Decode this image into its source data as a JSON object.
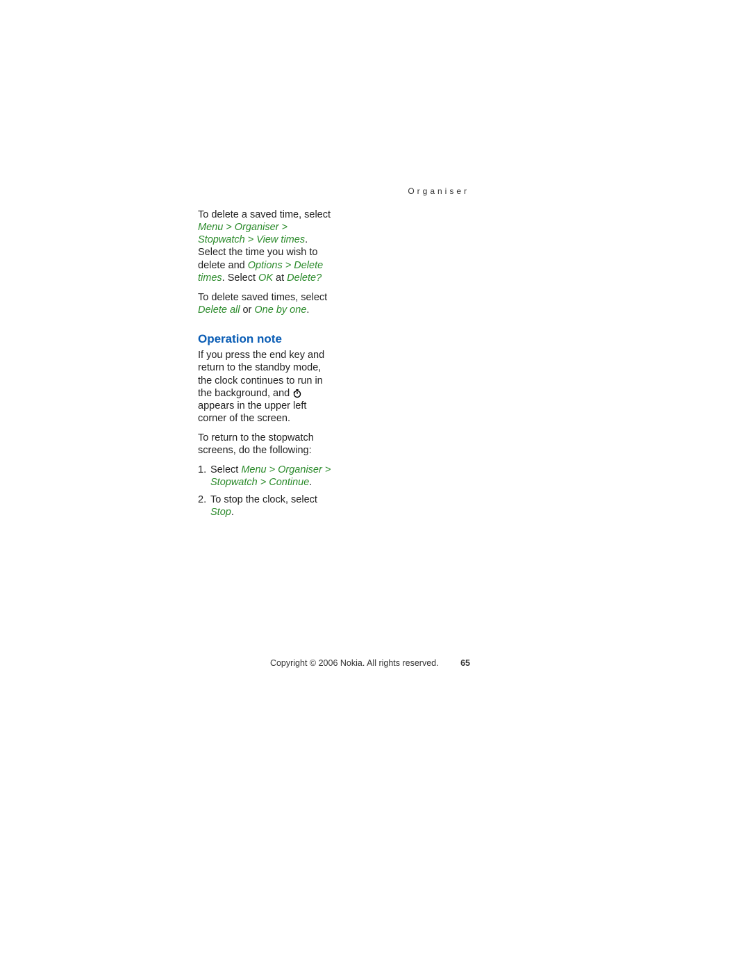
{
  "header": {
    "section": "Organiser"
  },
  "body": {
    "p1_a": "To delete a saved time, select ",
    "p1_nav1": "Menu > Organiser > Stopwatch > View times",
    "p1_b": ". Select the time you wish to delete and ",
    "p1_nav2": "Options > Delete times",
    "p1_c": ". Select ",
    "p1_ok": "OK",
    "p1_d": " at ",
    "p1_delq": "Delete?",
    "p2_a": "To delete saved times, select ",
    "p2_da": "Delete all",
    "p2_b": " or ",
    "p2_obo": "One by one",
    "p2_c": ".",
    "heading": "Operation note",
    "p3_a": "If you press the end key and return to the standby mode, the clock continues to run in the background, and ",
    "p3_b": " appears in the upper left corner of the screen.",
    "p4": "To return to the stopwatch screens, do the following:",
    "li1_a": "Select ",
    "li1_nav": "Menu > Organiser > Stopwatch > Continue",
    "li1_b": ".",
    "li2_a": "To stop the clock, select ",
    "li2_stop": "Stop",
    "li2_b": ".",
    "num1": "1.",
    "num2": "2."
  },
  "footer": {
    "copyright": "Copyright © 2006 Nokia. All rights reserved.",
    "page": "65"
  }
}
